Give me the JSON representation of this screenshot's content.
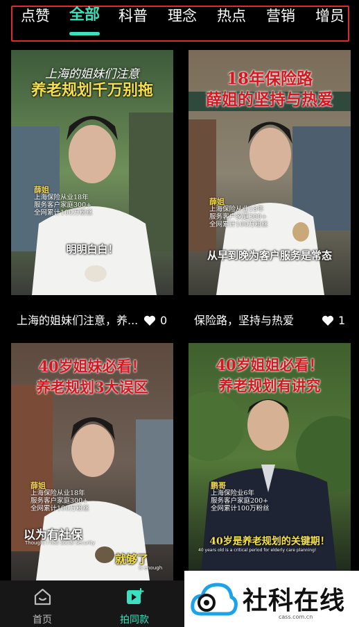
{
  "tabs": [
    {
      "label": "点赞"
    },
    {
      "label": "全部",
      "active": true
    },
    {
      "label": "科普"
    },
    {
      "label": "理念"
    },
    {
      "label": "热点"
    },
    {
      "label": "营销"
    },
    {
      "label": "增员"
    }
  ],
  "cards": [
    {
      "title_top": "上海的姐妹们注意",
      "title_main": "养老规划千万别拖",
      "name": "薛姐",
      "info": [
        "上海保险从业18年",
        "服务客户家庭300+",
        "全网累计100万粉丝"
      ],
      "caption": "明明白白！",
      "description": "上海的姐妹们注意，养...",
      "likes": "0"
    },
    {
      "title_top": "18年保险路",
      "title_main": "薛姐的坚持与热爱",
      "name": "薛姐",
      "info": [
        "上海保险从业18年",
        "服务客户家庭300+",
        "全网累计100万粉丝"
      ],
      "caption": "从早到晚为客户服务是常态",
      "description": "保险路，坚持与热爱",
      "likes": "1"
    },
    {
      "title_top": "40岁姐妹必看！",
      "title_main": "养老规划3大误区",
      "name": "薛姐",
      "info": [
        "上海保险从业18年",
        "服务客户家庭300+",
        "全网累计100万粉丝"
      ],
      "caption": "以为有社保",
      "caption_sub": "Thought I had social security",
      "caption2": "就够了",
      "caption2_sub": "is enough"
    },
    {
      "title_top": "40岁姐姐必看！",
      "title_main": "养老规划有讲究",
      "name": "鹏哥",
      "info": [
        "上海保险业6年",
        "服务客户家庭200+",
        "全网累计100万粉丝"
      ],
      "caption": "40岁是养老规划的关键期！",
      "caption_sub": "40 years old is a critical period for elderly care planning!"
    }
  ],
  "bottom_nav": [
    {
      "label": "首页",
      "icon": "home-icon",
      "active": false
    },
    {
      "label": "拍同款",
      "icon": "video-plus-icon",
      "active": true
    }
  ],
  "watermark": {
    "text": "社科在线",
    "url": "cass.com.cn",
    "icon": "cloud-logo-icon"
  },
  "colors": {
    "accent": "#3be0c0",
    "frame": "#e0282f",
    "title_red": "#d7171f",
    "title_yellow": "#f5e04a"
  }
}
